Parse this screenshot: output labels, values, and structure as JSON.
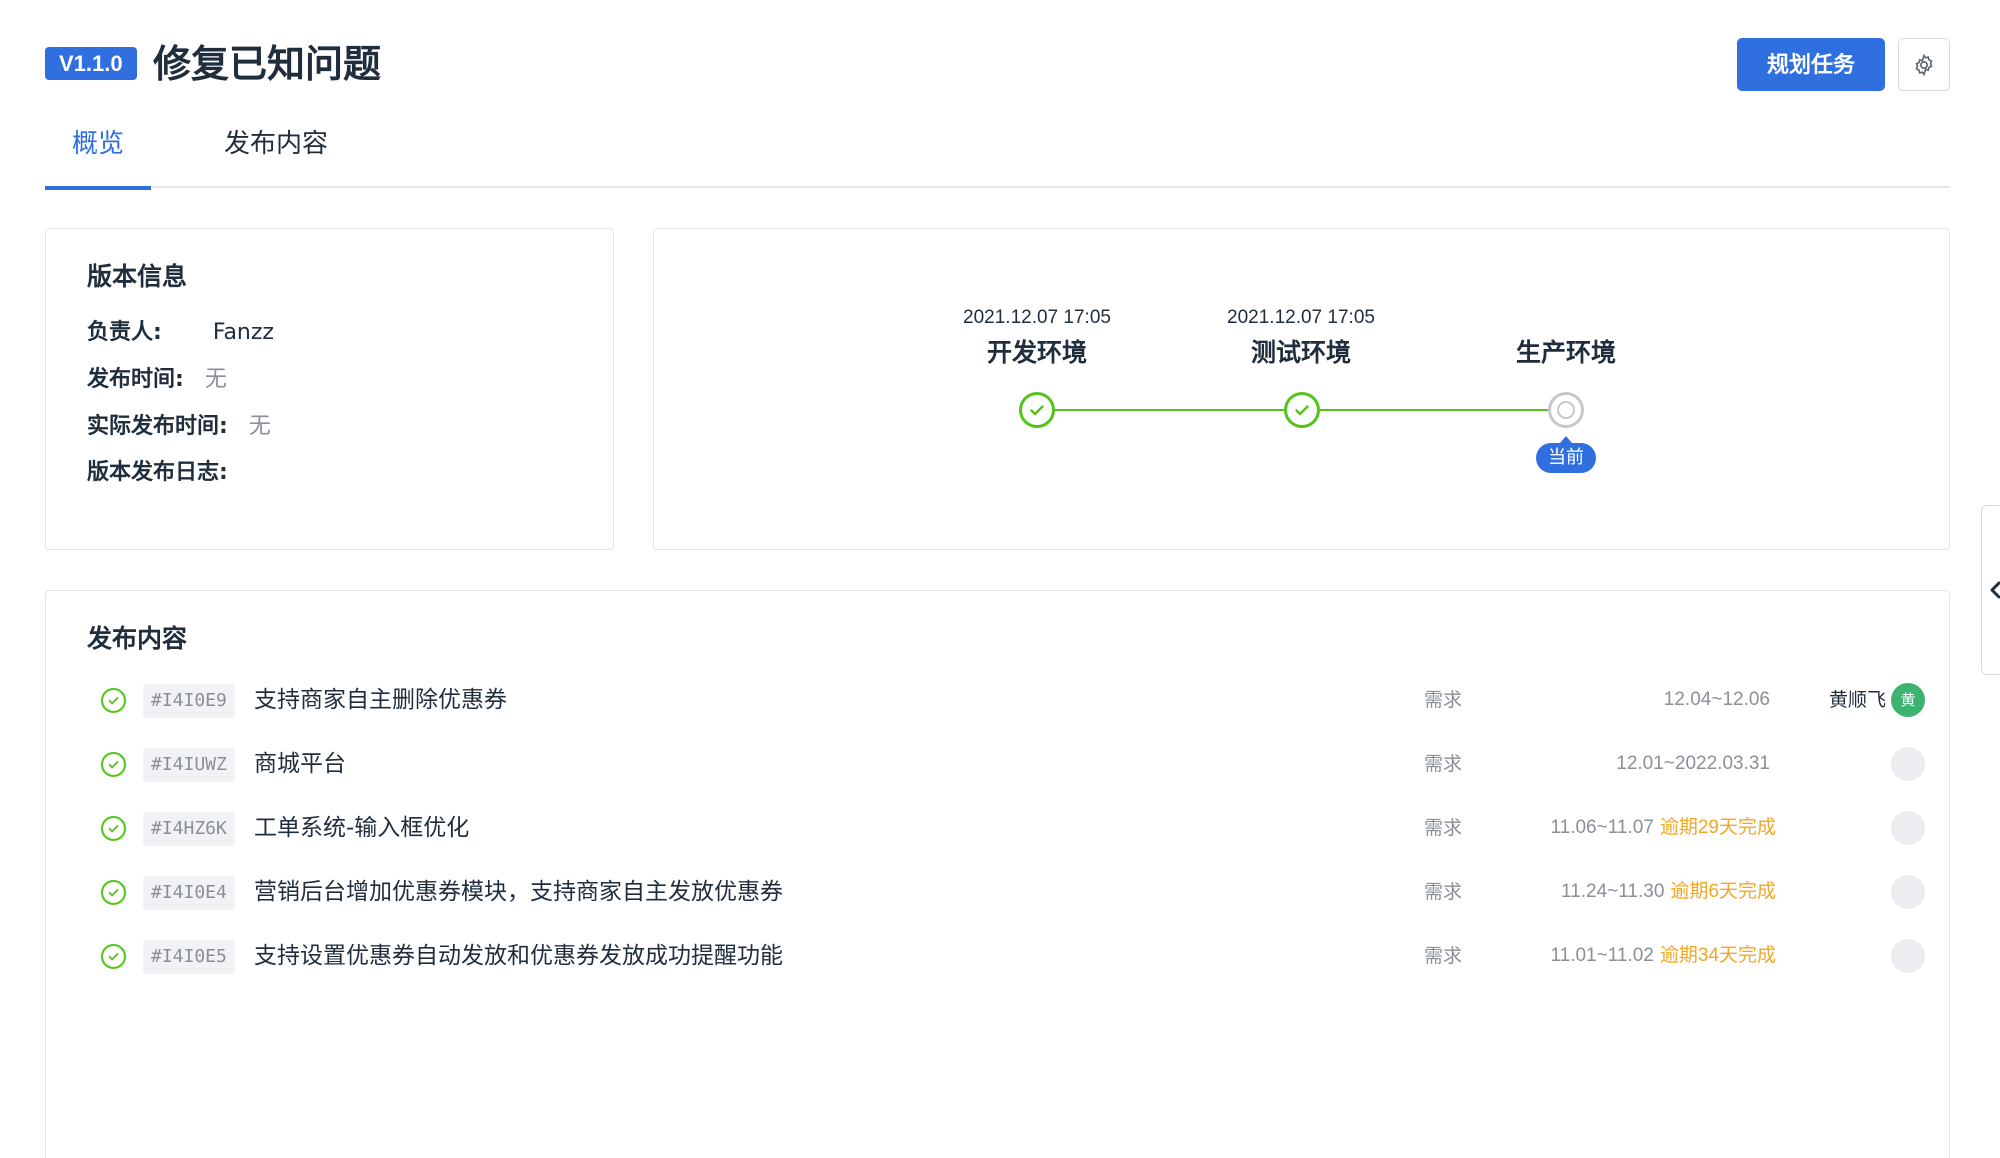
{
  "header": {
    "version": "V1.1.0",
    "title": "修复已知问题",
    "plan_button": "规划任务",
    "settings_icon": "gear-icon"
  },
  "tabs": [
    {
      "label": "概览",
      "active": true
    },
    {
      "label": "发布内容",
      "active": false
    }
  ],
  "version_info": {
    "title": "版本信息",
    "owner_label": "负责人:",
    "owner_value": "Fanzz",
    "release_time_label": "发布时间:",
    "release_time_value": "无",
    "actual_release_time_label": "实际发布时间:",
    "actual_release_time_value": "无",
    "release_log_label": "版本发布日志:"
  },
  "pipeline": {
    "stages": [
      {
        "time": "2021.12.07 17:05",
        "name": "开发环境",
        "status": "done"
      },
      {
        "time": "2021.12.07 17:05",
        "name": "测试环境",
        "status": "done"
      },
      {
        "time": "",
        "name": "生产环境",
        "status": "current"
      }
    ],
    "current_tag": "当前",
    "done_color": "#52c41a",
    "accent_color": "#2f6fe0"
  },
  "release_content": {
    "title": "发布内容",
    "items": [
      {
        "code": "#I4I0E9",
        "name": "支持商家自主删除优惠券",
        "type": "需求",
        "dates": "12.04~12.06",
        "overdue": "",
        "assignee": "黄顺飞",
        "avatar": "黄"
      },
      {
        "code": "#I4IUWZ",
        "name": "商城平台",
        "type": "需求",
        "dates": "12.01~2022.03.31",
        "overdue": "",
        "assignee": "",
        "avatar": ""
      },
      {
        "code": "#I4HZ6K",
        "name": "工单系统-输入框优化",
        "type": "需求",
        "dates": "11.06~11.07",
        "overdue": "逾期29天完成",
        "assignee": "",
        "avatar": ""
      },
      {
        "code": "#I4I0E4",
        "name": "营销后台增加优惠券模块，支持商家自主发放优惠券",
        "type": "需求",
        "dates": "11.24~11.30",
        "overdue": "逾期6天完成",
        "assignee": "",
        "avatar": ""
      },
      {
        "code": "#I4I0E5",
        "name": "支持设置优惠券自动发放和优惠券发放成功提醒功能",
        "type": "需求",
        "dates": "11.01~11.02",
        "overdue": "逾期34天完成",
        "assignee": "",
        "avatar": ""
      }
    ]
  }
}
